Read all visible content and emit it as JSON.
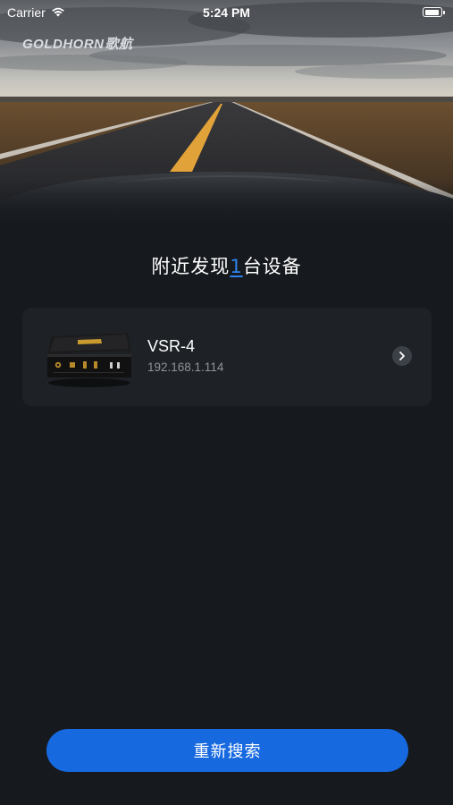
{
  "status_bar": {
    "carrier": "Carrier",
    "time": "5:24 PM"
  },
  "logo": {
    "en": "GOLDHORN",
    "cn": "歌航"
  },
  "heading": {
    "prefix": "附近发现",
    "count": "1",
    "suffix": "台设备"
  },
  "devices": [
    {
      "name": "VSR-4",
      "ip": "192.168.1.114"
    }
  ],
  "rescan_button": {
    "label": "重新搜索"
  },
  "colors": {
    "background": "#16191d",
    "card": "#1e2227",
    "accent": "#1769e0",
    "count_highlight": "#2f82ee"
  },
  "icons": {
    "wifi": "wifi-icon",
    "battery": "battery-icon",
    "chevron": "chevron-right-icon"
  }
}
